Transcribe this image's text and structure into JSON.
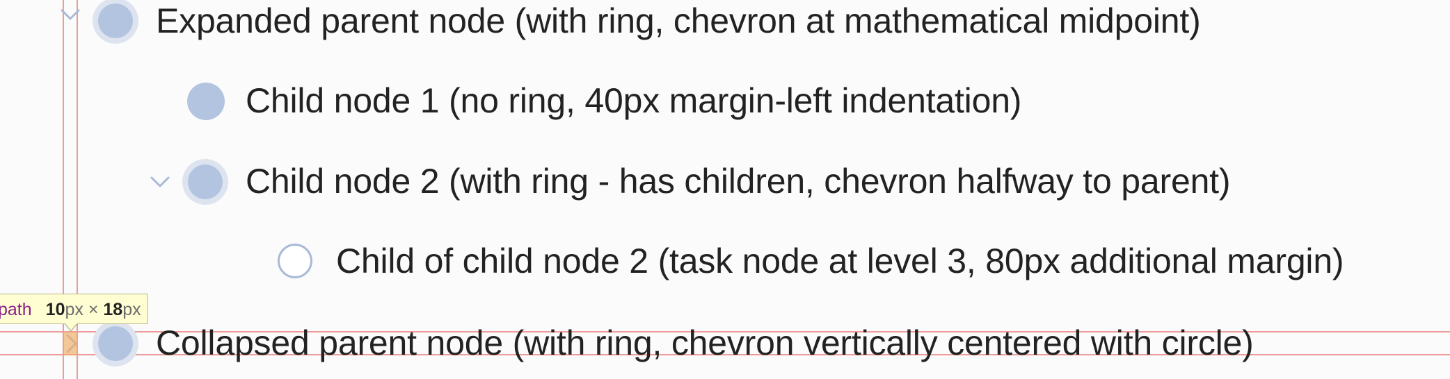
{
  "nodes": [
    {
      "label": "Expanded parent node (with ring, chevron at mathematical midpoint)",
      "bullet": "ringed",
      "chevron": "down"
    },
    {
      "label": "Child node 1 (no ring, 40px margin-left indentation)",
      "bullet": "filled",
      "chevron": "none"
    },
    {
      "label": "Child node 2 (with ring - has children, chevron halfway to parent)",
      "bullet": "ringed",
      "chevron": "down"
    },
    {
      "label": "Child of child node 2 (task node at level 3, 80px additional margin)",
      "bullet": "task",
      "chevron": "none"
    },
    {
      "label": "Collapsed parent node (with ring, chevron vertically centered with circle)",
      "bullet": "ringed",
      "chevron": "right"
    }
  ],
  "inspector": {
    "tag": "path",
    "width_value": "10",
    "height_value": "18",
    "unit": "px",
    "times": "×"
  },
  "colors": {
    "bullet_fill": "#b3c4e0",
    "bullet_ring": "#dde4f0",
    "chevron": "#a9b9d6",
    "guide_line": "#ec9a9a",
    "highlight": "#f0aa64",
    "tooltip_bg": "#fffdd2"
  }
}
